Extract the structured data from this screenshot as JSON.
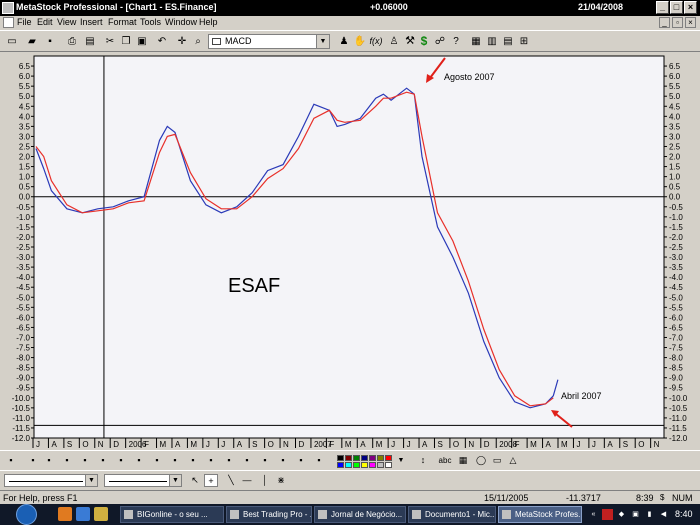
{
  "window": {
    "title": "MetaStock Professional - [Chart1 - ES.Finance]",
    "value": "+0.06000",
    "date": "21/04/2008"
  },
  "menu": {
    "items": [
      "File",
      "Edit",
      "View",
      "Insert",
      "Format",
      "Tools",
      "Window",
      "Help"
    ]
  },
  "toolbar": {
    "indicator_select": "MACD",
    "fx_label": "f(x)",
    "dollar": "$",
    "abc": "abc"
  },
  "annotations": {
    "chart_label": "ESAF",
    "peak_label": "Agosto 2007",
    "trough_label": "Abril 2007"
  },
  "statusbar": {
    "help": "For Help, press F1",
    "date": "15/11/2005",
    "value": "-11.3717",
    "time": "8:39",
    "num": "NUM"
  },
  "taskbar": {
    "tasks": [
      "BIGonline - o seu ...",
      "Best Trading Pro - ...",
      "Jornal de Negócio...",
      "Documento1 - Mic...",
      "MetaStock Profes..."
    ],
    "clock": "8:40"
  },
  "colors": {
    "macd_line": "#2b3ab8",
    "signal_line": "#e8302a",
    "arrow": "#e0201a",
    "chart_bg": "#f4f4f8"
  },
  "chart_data": {
    "type": "line",
    "ylim": [
      -12,
      7
    ],
    "yticks": [
      "6.5",
      "6.0",
      "5.5",
      "5.0",
      "4.5",
      "4.0",
      "3.5",
      "3.0",
      "2.5",
      "2.0",
      "1.5",
      "1.0",
      "0.5",
      "0.0",
      "-0.5",
      "-1.0",
      "-1.5",
      "-2.0",
      "-2.5",
      "-3.0",
      "-3.5",
      "-4.0",
      "-4.5",
      "-5.0",
      "-5.5",
      "-6.0",
      "-6.5",
      "-7.0",
      "-7.5",
      "-8.0",
      "-8.5",
      "-9.0",
      "-9.5",
      "-10.0",
      "-10.5",
      "-11.0",
      "-11.5",
      "-12.0"
    ],
    "x_labels": [
      "J",
      "A",
      "S",
      "O",
      "N",
      "D",
      "2006",
      "F",
      "M",
      "A",
      "M",
      "J",
      "J",
      "A",
      "S",
      "O",
      "N",
      "D",
      "2007",
      "F",
      "M",
      "A",
      "M",
      "J",
      "J",
      "A",
      "S",
      "O",
      "N",
      "D",
      "2008",
      "F",
      "M",
      "A",
      "M",
      "J",
      "J",
      "A",
      "S",
      "O",
      "N"
    ],
    "x_index": [
      0,
      1,
      2,
      3,
      4,
      5,
      6,
      7,
      8,
      9,
      10,
      11,
      12,
      13,
      14,
      15,
      16,
      17,
      18,
      19,
      20,
      21,
      22,
      23,
      24,
      25,
      26,
      27,
      28,
      29,
      30,
      31,
      32,
      33,
      34,
      35,
      36,
      37,
      38,
      39,
      40
    ],
    "series": [
      {
        "name": "",
        "x": [
          0,
          0.5,
          1,
          2,
          3,
          4,
          5,
          6,
          7,
          8,
          8.5,
          9,
          10,
          11,
          12,
          13,
          14,
          15,
          16,
          17,
          18,
          19,
          19.5,
          20,
          21,
          22,
          22.5,
          23,
          24,
          24.5,
          25,
          26,
          27,
          28,
          29,
          30,
          31,
          32,
          33,
          33.5,
          33.8
        ],
        "values": [
          2.4,
          1.4,
          0.3,
          -0.6,
          -0.8,
          -0.6,
          -0.5,
          -0.2,
          0.0,
          2.8,
          3.5,
          3.2,
          0.8,
          -0.4,
          -0.8,
          -0.5,
          0.2,
          1.3,
          1.6,
          3.0,
          4.6,
          4.3,
          3.5,
          3.6,
          3.9,
          4.9,
          5.1,
          4.8,
          5.4,
          5.1,
          2.0,
          -1.5,
          -3.0,
          -4.8,
          -7.2,
          -9.0,
          -10.2,
          -10.5,
          -10.3,
          -9.9,
          -9.1
        ]
      },
      {
        "name": "",
        "x": [
          0,
          0.5,
          1,
          2,
          3,
          4,
          5,
          6,
          7,
          8,
          8.5,
          9,
          10,
          11,
          12,
          13,
          14,
          15,
          16,
          17,
          18,
          19,
          19.5,
          20,
          21,
          22,
          22.5,
          23,
          24,
          24.5,
          25,
          26,
          27,
          28,
          29,
          30,
          31,
          32,
          33,
          33.5
        ],
        "values": [
          2.5,
          2.0,
          0.8,
          -0.4,
          -0.8,
          -0.7,
          -0.6,
          -0.3,
          -0.2,
          2.2,
          3.0,
          3.1,
          1.2,
          -0.1,
          -0.6,
          -0.6,
          0.0,
          0.9,
          1.4,
          2.4,
          3.9,
          4.3,
          3.8,
          3.7,
          3.8,
          4.5,
          4.9,
          4.9,
          5.2,
          5.1,
          3.0,
          -0.8,
          -2.2,
          -4.2,
          -6.6,
          -8.6,
          -9.9,
          -10.4,
          -10.3,
          -10.0
        ]
      }
    ],
    "grid": false
  }
}
